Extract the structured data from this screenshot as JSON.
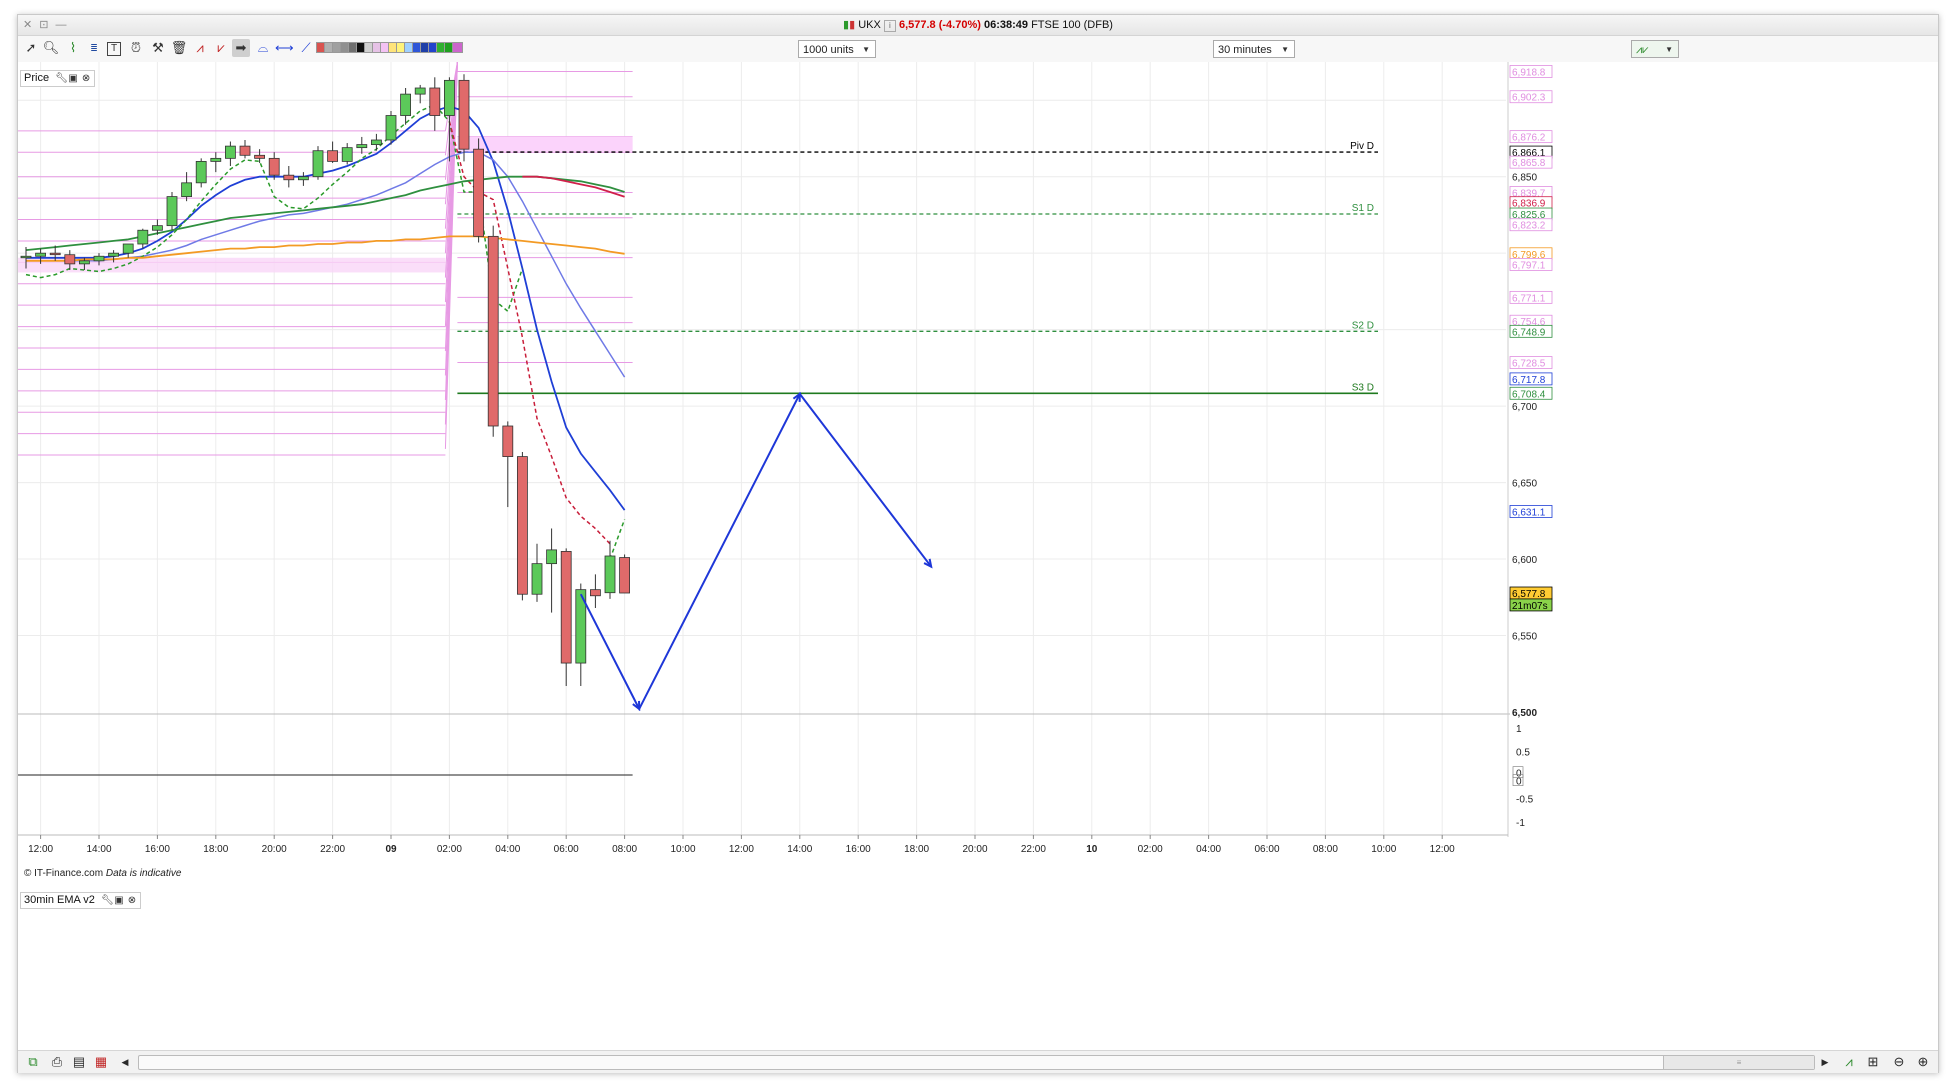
{
  "window": {
    "controls": "✕ ⊡ —",
    "symbol": "UKX",
    "price_change": "6,577.8 (-4.70%)",
    "time": "06:38:49",
    "instrument": "FTSE 100 (DFB)"
  },
  "toolbar": {
    "units_select": "1000 units",
    "interval_select": "30 minutes",
    "icons": [
      "pointer-icon",
      "zoom-icon",
      "indicator-icon",
      "pivot-icon",
      "text-icon",
      "alert-icon",
      "tools-icon",
      "delete-icon",
      "trendline-icon",
      "fibonacci-icon",
      "arrow-icon",
      "shape-icon",
      "horizontal-line-icon",
      "line-icon"
    ],
    "swatches": [
      "#d9534f",
      "#b0b0b0",
      "#a0a0a0",
      "#909090",
      "#707070",
      "#101010",
      "#d0d0d0",
      "#e6c2e6",
      "#f4c2f4",
      "#ffe47a",
      "#fff37a",
      "#9fd0ff",
      "#2d55d8",
      "#1e3fa8",
      "#2244cc",
      "#30b030",
      "#20a020",
      "#cc66cc"
    ]
  },
  "panels": {
    "price_label": "Price",
    "indicator_label": "30min EMA v2",
    "footer_source": "© IT-Finance.com",
    "footer_note": "Data is indicative"
  },
  "colors": {
    "up": "#5cc95a",
    "down": "#e06a6a",
    "ema_blue": "#1f3fd6",
    "ema_lightblue": "#6f7ae6",
    "green_ma": "#2f8f3f",
    "red_ma": "#d0204a",
    "orange_ma": "#f39a24",
    "pivot_pink": "#e79ae4",
    "projection": "#1e37d8"
  },
  "chart_data": {
    "type": "candlestick",
    "title": "",
    "instrument": "UKX",
    "interval": "30 minutes",
    "xlabel": "",
    "ylabel": "",
    "ylim": [
      6500,
      6925
    ],
    "x_ticks": [
      "12:00",
      "14:00",
      "16:00",
      "18:00",
      "20:00",
      "22:00",
      "09",
      "02:00",
      "04:00",
      "06:00",
      "08:00",
      "10:00",
      "12:00",
      "14:00",
      "16:00",
      "18:00",
      "20:00",
      "22:00",
      "10",
      "02:00",
      "04:00",
      "06:00",
      "08:00",
      "10:00",
      "12:00"
    ],
    "y_ticks": [
      "6,850",
      "6,700",
      "6,650",
      "6,600",
      "6,550",
      "6,500"
    ],
    "candles": [
      {
        "o": 6797,
        "h": 6804,
        "l": 6790,
        "c": 6798
      },
      {
        "o": 6798,
        "h": 6803,
        "l": 6793,
        "c": 6800
      },
      {
        "o": 6800,
        "h": 6805,
        "l": 6795,
        "c": 6799
      },
      {
        "o": 6799,
        "h": 6802,
        "l": 6789,
        "c": 6793
      },
      {
        "o": 6793,
        "h": 6797,
        "l": 6789,
        "c": 6795
      },
      {
        "o": 6795,
        "h": 6800,
        "l": 6792,
        "c": 6798
      },
      {
        "o": 6798,
        "h": 6802,
        "l": 6794,
        "c": 6800
      },
      {
        "o": 6800,
        "h": 6806,
        "l": 6797,
        "c": 6806
      },
      {
        "o": 6806,
        "h": 6816,
        "l": 6803,
        "c": 6815
      },
      {
        "o": 6815,
        "h": 6822,
        "l": 6812,
        "c": 6818
      },
      {
        "o": 6818,
        "h": 6840,
        "l": 6815,
        "c": 6837
      },
      {
        "o": 6837,
        "h": 6853,
        "l": 6834,
        "c": 6846
      },
      {
        "o": 6846,
        "h": 6862,
        "l": 6843,
        "c": 6860
      },
      {
        "o": 6860,
        "h": 6866,
        "l": 6853,
        "c": 6862
      },
      {
        "o": 6862,
        "h": 6873,
        "l": 6857,
        "c": 6870
      },
      {
        "o": 6870,
        "h": 6874,
        "l": 6862,
        "c": 6864
      },
      {
        "o": 6864,
        "h": 6868,
        "l": 6859,
        "c": 6862
      },
      {
        "o": 6862,
        "h": 6866,
        "l": 6848,
        "c": 6851
      },
      {
        "o": 6851,
        "h": 6857,
        "l": 6843,
        "c": 6848
      },
      {
        "o": 6848,
        "h": 6853,
        "l": 6844,
        "c": 6850
      },
      {
        "o": 6850,
        "h": 6870,
        "l": 6848,
        "c": 6867
      },
      {
        "o": 6867,
        "h": 6873,
        "l": 6859,
        "c": 6860
      },
      {
        "o": 6860,
        "h": 6872,
        "l": 6858,
        "c": 6869
      },
      {
        "o": 6869,
        "h": 6876,
        "l": 6865,
        "c": 6871
      },
      {
        "o": 6871,
        "h": 6878,
        "l": 6867,
        "c": 6874
      },
      {
        "o": 6874,
        "h": 6893,
        "l": 6871,
        "c": 6890
      },
      {
        "o": 6890,
        "h": 6908,
        "l": 6884,
        "c": 6904
      },
      {
        "o": 6904,
        "h": 6910,
        "l": 6898,
        "c": 6908
      },
      {
        "o": 6908,
        "h": 6915,
        "l": 6880,
        "c": 6890
      },
      {
        "o": 6890,
        "h": 6915,
        "l": 6860,
        "c": 6913
      },
      {
        "o": 6913,
        "h": 6917,
        "l": 6860,
        "c": 6868
      },
      {
        "o": 6868,
        "h": 6875,
        "l": 6807,
        "c": 6811
      },
      {
        "o": 6811,
        "h": 6818,
        "l": 6680,
        "c": 6687
      },
      {
        "o": 6687,
        "h": 6690,
        "l": 6634,
        "c": 6667
      },
      {
        "o": 6667,
        "h": 6670,
        "l": 6573,
        "c": 6577
      },
      {
        "o": 6577,
        "h": 6610,
        "l": 6572,
        "c": 6597
      },
      {
        "o": 6597,
        "h": 6620,
        "l": 6565,
        "c": 6606
      },
      {
        "o": 6605,
        "h": 6607,
        "l": 6517,
        "c": 6532
      },
      {
        "o": 6532,
        "h": 6584,
        "l": 6517,
        "c": 6580
      },
      {
        "o": 6580,
        "h": 6590,
        "l": 6568,
        "c": 6576
      },
      {
        "o": 6578,
        "h": 6612,
        "l": 6574,
        "c": 6602
      },
      {
        "o": 6601,
        "h": 6603,
        "l": 6578,
        "c": 6577.8
      }
    ],
    "series": [
      {
        "name": "",
        "style": "blue",
        "values": [
          6797,
          6797,
          6797,
          6797,
          6797,
          6797,
          6798,
          6800,
          6803,
          6808,
          6814,
          6822,
          6831,
          6838,
          6844,
          6848,
          6850,
          6850,
          6850,
          6850,
          6852,
          6854,
          6857,
          6861,
          6865,
          6872,
          6880,
          6888,
          6893,
          6896,
          6893,
          6882,
          6860,
          6828,
          6790,
          6750,
          6716,
          6686,
          6669,
          6657,
          6645,
          6632
        ]
      },
      {
        "name": "",
        "style": "lightblue",
        "values": [
          6795,
          6795,
          6795,
          6795,
          6795,
          6795,
          6796,
          6797,
          6798,
          6800,
          6802,
          6805,
          6809,
          6812,
          6815,
          6818,
          6821,
          6823,
          6825,
          6826,
          6828,
          6830,
          6832,
          6835,
          6838,
          6842,
          6846,
          6852,
          6858,
          6863,
          6866,
          6866,
          6861,
          6850,
          6834,
          6816,
          6798,
          6780,
          6764,
          6749,
          6734,
          6719
        ]
      },
      {
        "name": "",
        "style": "green-dashed",
        "values": [
          6786,
          6784,
          6786,
          6790,
          6789,
          6788,
          6790,
          6793,
          6798,
          6804,
          6812,
          6822,
          6834,
          6845,
          6855,
          6861,
          6860,
          6837,
          6830,
          6829,
          6836,
          6845,
          6853,
          6862,
          6868,
          6877,
          6885,
          6893,
          6897,
          6886,
          6840,
          6840,
          6770,
          6762,
          6790,
          null,
          null,
          null,
          null,
          null,
          6600,
          6626
        ]
      },
      {
        "name": "",
        "style": "red-dashed",
        "values": [
          null,
          null,
          null,
          null,
          null,
          null,
          null,
          null,
          null,
          null,
          null,
          null,
          null,
          null,
          null,
          null,
          null,
          null,
          null,
          null,
          null,
          null,
          null,
          null,
          null,
          null,
          null,
          null,
          null,
          6886,
          6850,
          6840,
          6835,
          6790,
          6745,
          6692,
          6667,
          6640,
          6628,
          6620,
          6610,
          null
        ]
      },
      {
        "name": "",
        "style": "green",
        "values": [
          6802,
          6803,
          6804,
          6805,
          6806,
          6807,
          6808,
          6809,
          6811,
          6813,
          6815,
          6817,
          6819,
          6821,
          6823,
          6824,
          6825,
          6826,
          6827,
          6828,
          6829,
          6830,
          6831,
          6832,
          6834,
          6836,
          6838,
          6841,
          6843,
          6845,
          6847,
          6848,
          6849,
          6850,
          6850,
          6850,
          6849,
          6848,
          6847,
          6845,
          6843,
          6840
        ]
      },
      {
        "name": "",
        "style": "orange",
        "values": [
          6795,
          6795,
          6795,
          6795,
          6796,
          6796,
          6796,
          6797,
          6797,
          6798,
          6799,
          6800,
          6801,
          6802,
          6803,
          6803,
          6804,
          6804,
          6805,
          6805,
          6806,
          6806,
          6807,
          6807,
          6808,
          6808,
          6809,
          6809,
          6810,
          6811,
          6811,
          6811,
          6810,
          6809,
          6808,
          6807,
          6806,
          6805,
          6804,
          6803,
          6801,
          6799.6
        ]
      }
    ],
    "pivot_levels": [
      {
        "label": "Piv D",
        "value": 6866.1,
        "style": "black-dashed"
      },
      {
        "label": "S1 D",
        "value": 6825.6,
        "style": "green-dashed"
      },
      {
        "label": "S2 D",
        "value": 6748.9,
        "style": "green-dashed"
      },
      {
        "label": "S3 D",
        "value": 6708.4,
        "style": "green-solid"
      }
    ],
    "projection": [
      [
        6577,
        6500
      ],
      [
        6600,
        6500
      ]
    ],
    "projection_path": [
      {
        "x": "06:30",
        "y": 6577
      },
      {
        "x": "08:30",
        "y": 6502
      },
      {
        "x": "14:00",
        "y": 6708
      },
      {
        "x": "18:30",
        "y": 6595
      }
    ],
    "price_labels": [
      {
        "text": "6,918.8",
        "value": 6918.8,
        "color": "#e08ee0",
        "fill": "#fff"
      },
      {
        "text": "6,902.3",
        "value": 6902.3,
        "color": "#e08ee0",
        "fill": "#fff"
      },
      {
        "text": "6,876.2",
        "value": 6876.2,
        "color": "#e08ee0",
        "fill": "#fff"
      },
      {
        "text": "6,866.1",
        "value": 6866.1,
        "color": "#000000",
        "fill": "#fff"
      },
      {
        "text": "6,865.8",
        "value": 6859.5,
        "color": "#e08ee0",
        "fill": "#fff"
      },
      {
        "text": "6,839.7",
        "value": 6839.7,
        "color": "#e08ee0",
        "fill": "#fff"
      },
      {
        "text": "6,836.9",
        "value": 6833.0,
        "color": "#d0204a",
        "fill": "#fff"
      },
      {
        "text": "6,825.6",
        "value": 6825.6,
        "color": "#2f8f3f",
        "fill": "#fff"
      },
      {
        "text": "6,823.2",
        "value": 6818.6,
        "color": "#e08ee0",
        "fill": "#fff"
      },
      {
        "text": "6,799.6",
        "value": 6799.6,
        "color": "#f39a24",
        "fill": "#fff"
      },
      {
        "text": "6,797.1",
        "value": 6792.6,
        "color": "#e08ee0",
        "fill": "#fff"
      },
      {
        "text": "6,771.1",
        "value": 6771.1,
        "color": "#e08ee0",
        "fill": "#fff"
      },
      {
        "text": "6,754.6",
        "value": 6755.5,
        "color": "#e08ee0",
        "fill": "#fff"
      },
      {
        "text": "6,748.9",
        "value": 6748.9,
        "color": "#2f8f3f",
        "fill": "#fff"
      },
      {
        "text": "6,728.5",
        "value": 6728.5,
        "color": "#e08ee0",
        "fill": "#fff"
      },
      {
        "text": "6,717.8",
        "value": 6717.8,
        "color": "#1f3fd6",
        "fill": "#fff"
      },
      {
        "text": "6,708.4",
        "value": 6708.4,
        "color": "#2f8f3f",
        "fill": "#fff"
      },
      {
        "text": "6,631.1",
        "value": 6631.1,
        "color": "#1f3fd6",
        "fill": "#fff"
      },
      {
        "text": "6,577.8",
        "value": 6577.8,
        "color": "#000000",
        "fill": "#ffcc33"
      },
      {
        "text": "21m07s",
        "value": 6570.0,
        "color": "#000000",
        "fill": "#8ad34a"
      }
    ],
    "indicator": {
      "name": "30min EMA v2",
      "y_ticks": [
        "1",
        "0.5",
        "0",
        "0",
        "-0.5",
        "-1"
      ],
      "value": 0
    }
  }
}
